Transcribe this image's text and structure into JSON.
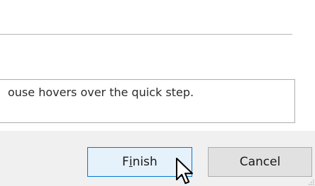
{
  "dialog": {
    "description_text": "ouse hovers over the quick step.",
    "buttons": {
      "finish": {
        "before": "F",
        "mnemonic": "i",
        "after": "nish"
      },
      "cancel": "Cancel"
    }
  },
  "colors": {
    "finish_border": "#0078d7",
    "finish_background": "#e5f1fb",
    "cancel_background": "#e1e1e1",
    "button_bar": "#f0f0f0"
  },
  "icons": {
    "cursor": "mouse-pointer-arrow",
    "resize": "resize-grip"
  }
}
